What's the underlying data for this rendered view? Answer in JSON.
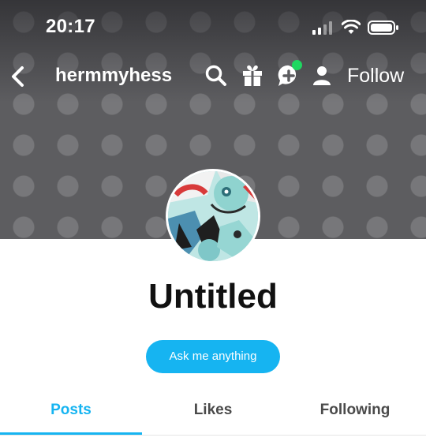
{
  "status_bar": {
    "time": "20:17"
  },
  "nav": {
    "back_icon": "chevron-left-icon",
    "username": "hermmyhess",
    "icons": [
      "search-icon",
      "gift-icon",
      "chat-plus-icon",
      "person-icon"
    ],
    "follow_label": "Follow",
    "notification_color": "#1ed760"
  },
  "profile": {
    "title": "Untitled",
    "ask_button_label": "Ask me anything"
  },
  "tabs": [
    {
      "label": "Posts",
      "active": true
    },
    {
      "label": "Likes",
      "active": false
    },
    {
      "label": "Following",
      "active": false
    }
  ],
  "colors": {
    "accent": "#16b4f1",
    "header_bg": "#5d5d60"
  }
}
